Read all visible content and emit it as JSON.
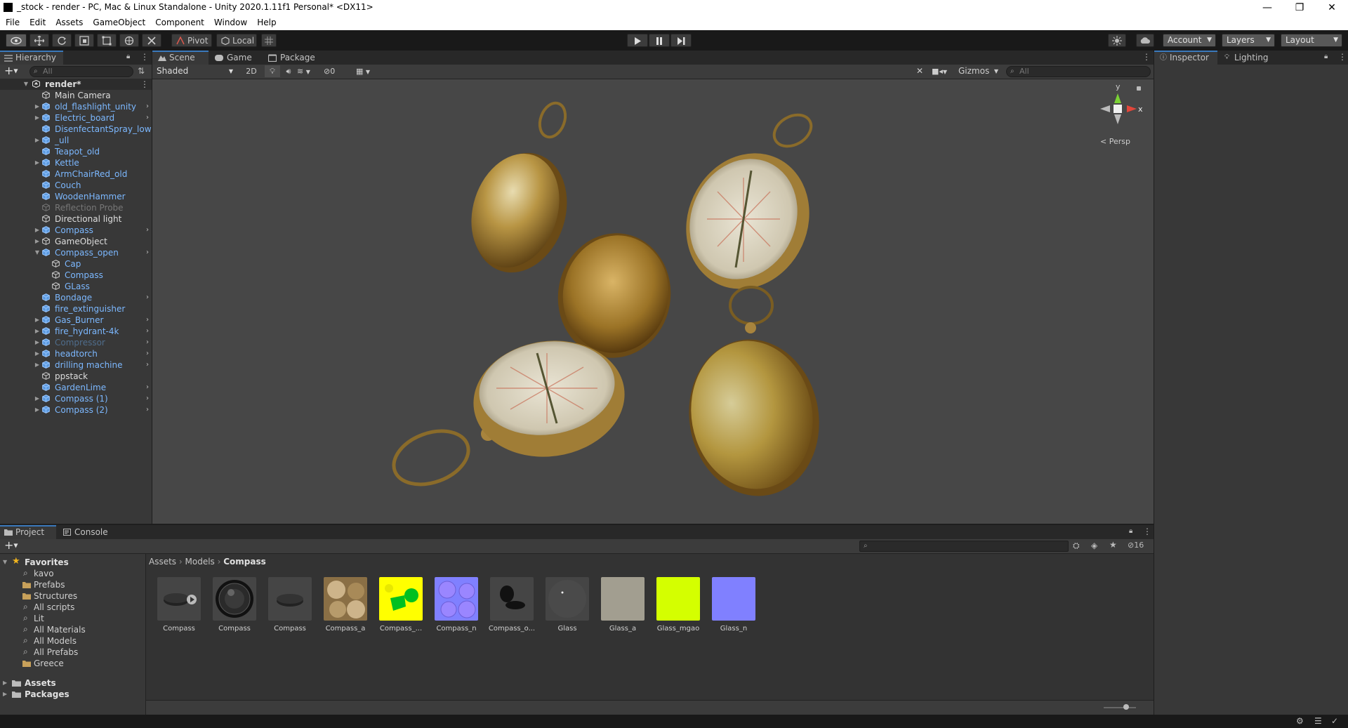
{
  "window": {
    "title": "_stock - render - PC, Mac & Linux Standalone - Unity 2020.1.11f1 Personal* <DX11>",
    "minimize": "—",
    "maximize": "❐",
    "close": "✕"
  },
  "menu": [
    "File",
    "Edit",
    "Assets",
    "GameObject",
    "Component",
    "Window",
    "Help"
  ],
  "toolbar": {
    "pivot": "Pivot",
    "local": "Local",
    "account": "Account",
    "layers": "Layers",
    "layout": "Layout"
  },
  "hierarchy": {
    "tab": "Hierarchy",
    "search_placeholder": "All",
    "root": "render*",
    "items": [
      {
        "label": "Main Camera"
      },
      {
        "label": "old_flashlight_unity"
      },
      {
        "label": "Electric_board"
      },
      {
        "label": "DisenfectantSpray_low"
      },
      {
        "label": "_ull"
      },
      {
        "label": "Teapot_old"
      },
      {
        "label": "Kettle"
      },
      {
        "label": "ArmChairRed_old"
      },
      {
        "label": "Couch"
      },
      {
        "label": "WoodenHammer"
      },
      {
        "label": "Reflection Probe"
      },
      {
        "label": "Directional light"
      },
      {
        "label": "Compass"
      },
      {
        "label": "GameObject"
      },
      {
        "label": "Compass_open"
      },
      {
        "label": "Cap"
      },
      {
        "label": "Compass"
      },
      {
        "label": "GLass"
      },
      {
        "label": "Bondage"
      },
      {
        "label": "fire_extinguisher"
      },
      {
        "label": "Gas_Burner"
      },
      {
        "label": "fire_hydrant-4k"
      },
      {
        "label": "Compressor"
      },
      {
        "label": "headtorch"
      },
      {
        "label": "drilling machine"
      },
      {
        "label": "ppstack"
      },
      {
        "label": "GardenLime"
      },
      {
        "label": "Compass (1)"
      },
      {
        "label": "Compass (2)"
      }
    ]
  },
  "scene": {
    "tabs": [
      "Scene",
      "Game",
      "Package Manager"
    ],
    "shading": "Shaded",
    "mode_2d": "2D",
    "hidden_count": "0",
    "gizmos": "Gizmos",
    "search_placeholder": "All",
    "axis_y": "y",
    "axis_x": "x",
    "persp": "< Persp"
  },
  "inspector": {
    "tabs": [
      "Inspector",
      "Lighting"
    ]
  },
  "project": {
    "tabs": [
      "Project",
      "Console"
    ],
    "favorites_title": "Favorites",
    "favorites": [
      "kavo",
      "Prefabs",
      "Structures",
      "All scripts",
      "Lit",
      "All Materials",
      "All Models",
      "All Prefabs",
      "Greece"
    ],
    "roots": [
      "Assets",
      "Packages"
    ],
    "breadcrumb": [
      "Assets",
      "Models",
      "Compass"
    ],
    "visible_count": "16",
    "assets": [
      {
        "label": "Compass"
      },
      {
        "label": "Compass"
      },
      {
        "label": "Compass"
      },
      {
        "label": "Compass_a"
      },
      {
        "label": "Compass_..."
      },
      {
        "label": "Compass_n"
      },
      {
        "label": "Compass_o..."
      },
      {
        "label": "Glass"
      },
      {
        "label": "Glass_a"
      },
      {
        "label": "Glass_mgao"
      },
      {
        "label": "Glass_n"
      }
    ]
  },
  "colors": {
    "accent_blue": "#3a79bb",
    "prefab_blue": "#7cb8ff",
    "gold": "#b8903e",
    "yellow_tex": "#ffff00",
    "normal_blue": "#8080ff",
    "lime": "#d4ff00"
  }
}
